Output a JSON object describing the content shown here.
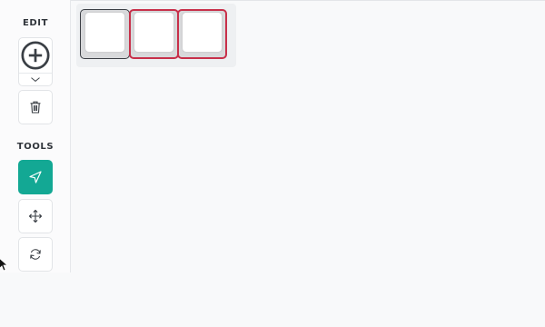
{
  "sidebar": {
    "edit_label": "EDIT",
    "tools_label": "TOOLS",
    "edit_buttons": [
      {
        "name": "add-key",
        "icon": "plus-circle-icon"
      },
      {
        "name": "expand",
        "icon": "chevron-down-icon"
      },
      {
        "name": "delete",
        "icon": "trash-icon"
      }
    ],
    "tool_buttons": [
      {
        "name": "select",
        "icon": "navigation-arrow-icon",
        "active": true
      },
      {
        "name": "move",
        "icon": "move-arrows-icon",
        "active": false
      },
      {
        "name": "rotate",
        "icon": "rotate-icon",
        "active": false
      }
    ]
  },
  "canvas": {
    "keys": [
      {
        "state": "normal"
      },
      {
        "state": "selected"
      },
      {
        "state": "selected"
      }
    ]
  },
  "colors": {
    "accent": "#13a894",
    "selection": "#c8304a",
    "key_border": "#3b3f45",
    "background": "#f8f9fa"
  }
}
